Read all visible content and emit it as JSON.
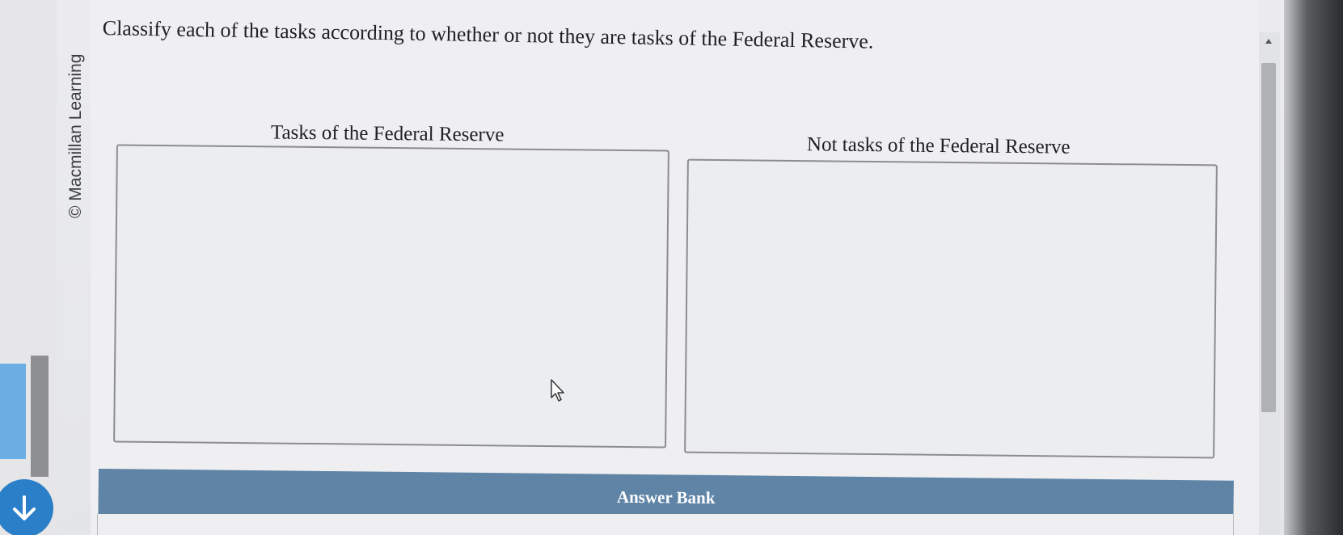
{
  "sidebar": {
    "copyright": "© Macmillan Learning"
  },
  "question": {
    "prompt": "Classify each of the tasks according to whether or not they are tasks of the Federal Reserve."
  },
  "columns": {
    "left_title": "Tasks of the Federal Reserve",
    "right_title": "Not tasks of the Federal Reserve"
  },
  "answer_bank": {
    "label": "Answer Bank"
  },
  "colors": {
    "answer_bank_header": "#5f84a6",
    "scroll_button": "#2b7fc8"
  }
}
